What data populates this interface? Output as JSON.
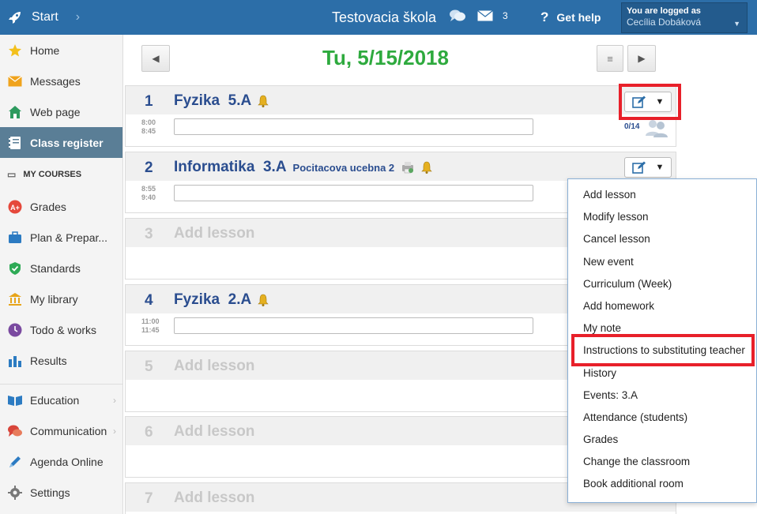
{
  "topbar": {
    "start_label": "Start",
    "school_name": "Testovacia škola",
    "message_count": "3",
    "help_label": "Get help",
    "logged_in_label": "You are logged as",
    "user_name": "Cecília Dobáková"
  },
  "sidebar": {
    "items": [
      {
        "label": "Home",
        "icon": "star-icon"
      },
      {
        "label": "Messages",
        "icon": "envelope-icon"
      },
      {
        "label": "Web page",
        "icon": "house-icon"
      },
      {
        "label": "Class register",
        "icon": "notebook-icon"
      }
    ],
    "courses_heading": "MY COURSES",
    "course_items": [
      {
        "label": "Grades",
        "icon": "grade-icon"
      },
      {
        "label": "Plan & Prepar...",
        "icon": "briefcase-icon"
      },
      {
        "label": "Standards",
        "icon": "shield-check-icon"
      },
      {
        "label": "My library",
        "icon": "library-icon"
      },
      {
        "label": "Todo & works",
        "icon": "clock-icon"
      },
      {
        "label": "Results",
        "icon": "bar-chart-icon"
      }
    ],
    "bottom_items": [
      {
        "label": "Education",
        "icon": "book-icon"
      },
      {
        "label": "Communication",
        "icon": "chat-icon"
      },
      {
        "label": "Agenda Online",
        "icon": "pen-icon"
      },
      {
        "label": "Settings",
        "icon": "gear-icon"
      }
    ]
  },
  "date_title": "Tu, 5/15/2018",
  "lessons": [
    {
      "num": "1",
      "subject": "Fyzika  5.A",
      "room": "",
      "time_start": "8:00",
      "time_end": "8:45",
      "count": "0/14"
    },
    {
      "num": "2",
      "subject": "Informatika  3.A",
      "room": "Pocitacova ucebna 2",
      "time_start": "8:55",
      "time_end": "9:40"
    },
    {
      "num": "3",
      "subject": "Add lesson"
    },
    {
      "num": "4",
      "subject": "Fyzika  2.A",
      "room": "",
      "time_start": "11:00",
      "time_end": "11:45"
    },
    {
      "num": "5",
      "subject": "Add lesson"
    },
    {
      "num": "6",
      "subject": "Add lesson"
    },
    {
      "num": "7",
      "subject": "Add lesson"
    }
  ],
  "menu": {
    "items": [
      "Add lesson",
      "Modify lesson",
      "Cancel lesson",
      "New event",
      "Curriculum (Week)",
      "Add homework",
      "My note",
      "Instructions to substituting teacher",
      "History",
      "Events: 3.A",
      "Attendance (students)",
      "Grades",
      "Change the classroom",
      "Book additional room"
    ]
  },
  "colors": {
    "topbar": "#2c6ea8",
    "date": "#2eaa3e",
    "subject": "#2a4d8f",
    "highlight": "#e8202a",
    "active_sidebar": "#5a7e96"
  }
}
